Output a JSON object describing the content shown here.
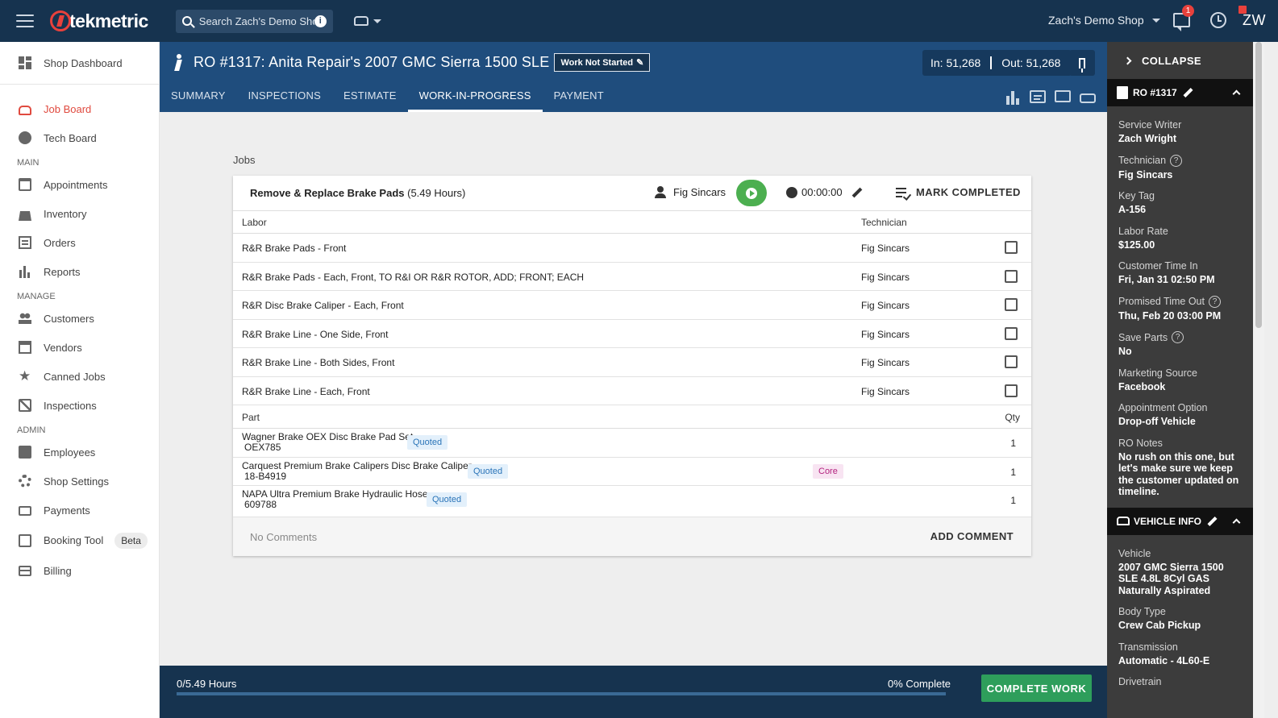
{
  "topbar": {
    "logo_text": "tekmetric",
    "search_placeholder": "Search Zach's Demo Shop",
    "shop_name": "Zach's Demo Shop",
    "messages_badge": "1",
    "user_initials": "ZW"
  },
  "sidebar": {
    "top_items": [
      {
        "label": "Shop Dashboard",
        "icon": "dashboard-icon"
      },
      {
        "label": "Job Board",
        "icon": "car-icon"
      },
      {
        "label": "Tech Board",
        "icon": "speedometer-icon"
      }
    ],
    "sections": [
      {
        "title": "MAIN",
        "items": [
          {
            "label": "Appointments",
            "icon": "calendar-icon"
          },
          {
            "label": "Inventory",
            "icon": "warehouse-icon"
          },
          {
            "label": "Orders",
            "icon": "list-icon"
          },
          {
            "label": "Reports",
            "icon": "bar-chart-icon"
          }
        ]
      },
      {
        "title": "MANAGE",
        "items": [
          {
            "label": "Customers",
            "icon": "people-icon"
          },
          {
            "label": "Vendors",
            "icon": "store-icon"
          },
          {
            "label": "Canned Jobs",
            "icon": "star-icon"
          },
          {
            "label": "Inspections",
            "icon": "clipboard-icon"
          }
        ]
      },
      {
        "title": "ADMIN",
        "items": [
          {
            "label": "Employees",
            "icon": "badge-icon"
          },
          {
            "label": "Shop Settings",
            "icon": "gear-icon"
          },
          {
            "label": "Payments",
            "icon": "payment-icon"
          },
          {
            "label": "Booking Tool",
            "icon": "booking-icon",
            "badge": "Beta"
          },
          {
            "label": "Billing",
            "icon": "credit-card-icon"
          }
        ]
      }
    ]
  },
  "ro": {
    "title": "RO #1317: Anita Repair's 2007 GMC Sierra 1500 SLE",
    "status": "Work Not Started",
    "mileage_in": "In: 51,268",
    "mileage_out": "Out: 51,268",
    "tabs": [
      "SUMMARY",
      "INSPECTIONS",
      "ESTIMATE",
      "WORK-IN-PROGRESS",
      "PAYMENT"
    ],
    "active_tab": "WORK-IN-PROGRESS"
  },
  "jobs": {
    "section_label": "Jobs",
    "job_name": "Remove & Replace Brake Pads",
    "job_hours": "(5.49 Hours)",
    "technician": "Fig Sincars",
    "timer": "00:00:00",
    "mark_completed": "MARK COMPLETED",
    "labor_header": "Labor",
    "technician_header": "Technician",
    "labor": [
      {
        "desc": "R&R Brake Pads - Front",
        "tech": "Fig Sincars"
      },
      {
        "desc": "R&R Brake Pads - Each, Front, TO R&I OR R&R ROTOR, ADD; FRONT; EACH",
        "tech": "Fig Sincars"
      },
      {
        "desc": "R&R Disc Brake Caliper - Each, Front",
        "tech": "Fig Sincars"
      },
      {
        "desc": "R&R Brake Line - One Side, Front",
        "tech": "Fig Sincars"
      },
      {
        "desc": "R&R Brake Line - Both Sides, Front",
        "tech": "Fig Sincars"
      },
      {
        "desc": "R&R Brake Line - Each, Front",
        "tech": "Fig Sincars"
      }
    ],
    "part_header": "Part",
    "qty_header": "Qty",
    "parts": [
      {
        "name": "Wagner Brake OEX Disc Brake Pad Set",
        "number": "OEX785",
        "status": "Quoted",
        "qty": "1"
      },
      {
        "name": "Carquest Premium Brake Calipers Disc Brake Caliper",
        "number": "18-B4919",
        "status": "Quoted",
        "core": "Core",
        "qty": "1"
      },
      {
        "name": "NAPA Ultra Premium Brake Hydraulic Hose",
        "number": "609788",
        "status": "Quoted",
        "qty": "1"
      }
    ],
    "no_comments": "No Comments",
    "add_comment": "ADD COMMENT"
  },
  "bottom": {
    "hours": "0/5.49 Hours",
    "percent": "0% Complete",
    "progress_fraction": 0,
    "complete_button": "COMPLETE WORK"
  },
  "panel": {
    "collapse": "COLLAPSE",
    "ro_section": "RO #1317",
    "fields": [
      {
        "label": "Service Writer",
        "value": "Zach Wright"
      },
      {
        "label": "Technician",
        "value": "Fig Sincars",
        "help": true
      },
      {
        "label": "Key Tag",
        "value": "A-156"
      },
      {
        "label": "Labor Rate",
        "value": "$125.00"
      },
      {
        "label": "Customer Time In",
        "value": "Fri, Jan 31 02:50 PM"
      },
      {
        "label": "Promised Time Out",
        "value": "Thu, Feb 20 03:00 PM",
        "help": true
      },
      {
        "label": "Save Parts",
        "value": "No",
        "help": true
      },
      {
        "label": "Marketing Source",
        "value": "Facebook"
      },
      {
        "label": "Appointment Option",
        "value": "Drop-off Vehicle"
      },
      {
        "label": "RO Notes",
        "value": "No rush on this one, but let's make sure we keep the customer updated on timeline."
      }
    ],
    "vehicle_section": "VEHICLE INFO",
    "vehicle_fields": [
      {
        "label": "Vehicle",
        "value": "2007 GMC Sierra 1500 SLE 4.8L 8Cyl GAS Naturally Aspirated"
      },
      {
        "label": "Body Type",
        "value": "Crew Cab Pickup"
      },
      {
        "label": "Transmission",
        "value": "Automatic - 4L60-E"
      },
      {
        "label": "Drivetrain",
        "value": ""
      }
    ]
  }
}
